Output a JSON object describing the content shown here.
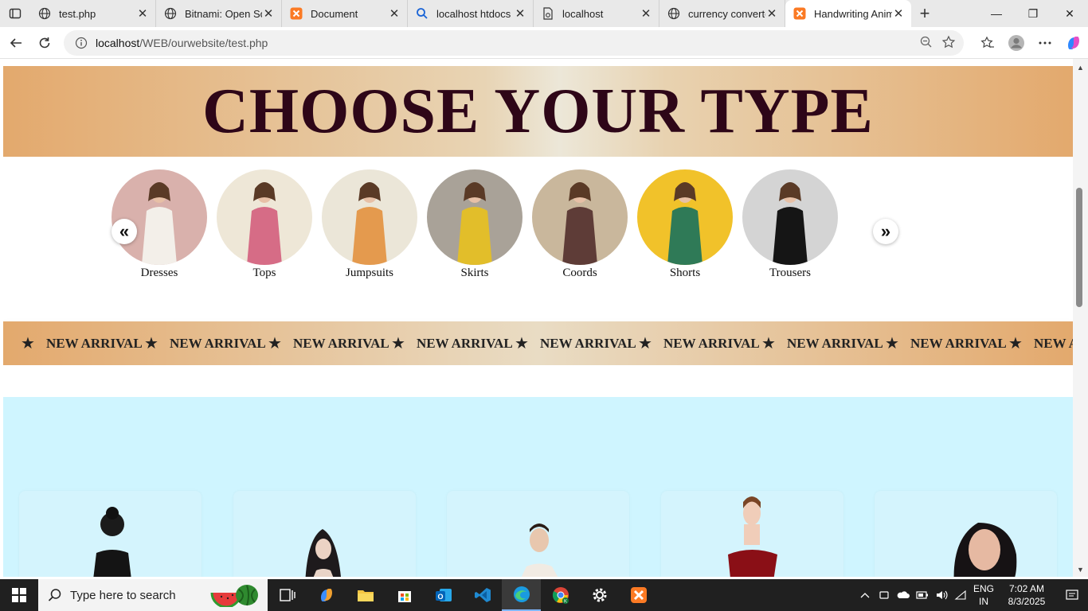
{
  "browser": {
    "tabs": [
      {
        "title": "test.php",
        "icon": "globe-icon"
      },
      {
        "title": "Bitnami: Open Sou",
        "icon": "globe-icon"
      },
      {
        "title": "Document",
        "icon": "xampp-icon"
      },
      {
        "title": "localhost htdocs in",
        "icon": "search-icon"
      },
      {
        "title": "localhost",
        "icon": "file-icon"
      },
      {
        "title": "currency converter",
        "icon": "globe-icon"
      },
      {
        "title": "Handwriting Anim",
        "icon": "xampp-icon",
        "active": true
      }
    ],
    "url_host": "localhost",
    "url_path": "/WEB/ourwebsite/test.php"
  },
  "page": {
    "banner_title": "CHOOSE YOUR TYPE",
    "categories": [
      {
        "label": "Dresses",
        "colors": [
          "#d9b1ac",
          "#f3efe9"
        ]
      },
      {
        "label": "Tops",
        "colors": [
          "#eee7d7",
          "#d66c86"
        ]
      },
      {
        "label": "Jumpsuits",
        "colors": [
          "#ebe6d8",
          "#e49a4e"
        ]
      },
      {
        "label": "Skirts",
        "colors": [
          "#a9a298",
          "#e2be2a"
        ]
      },
      {
        "label": "Coords",
        "colors": [
          "#c9b79c",
          "#5e3c37"
        ]
      },
      {
        "label": "Shorts",
        "colors": [
          "#f1c22a",
          "#2f7a57"
        ]
      },
      {
        "label": "Trousers",
        "colors": [
          "#d4d4d4",
          "#151515"
        ]
      }
    ],
    "marquee_text": "NEW ARRIVAL",
    "accent_color": "#2e0618"
  },
  "taskbar": {
    "search_placeholder": "Type here to search",
    "lang_1": "ENG",
    "lang_2": "IN",
    "time": "7:02 AM",
    "date": "8/3/2025"
  }
}
